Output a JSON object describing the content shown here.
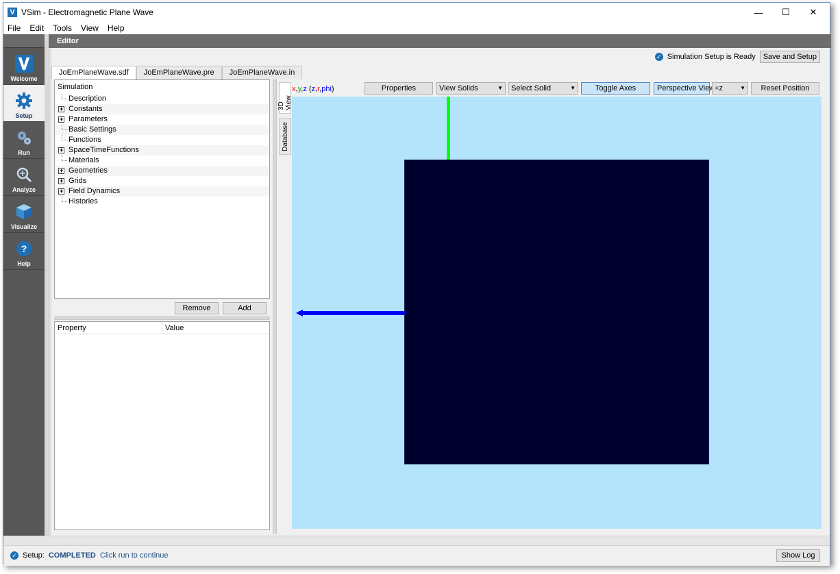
{
  "window": {
    "title": "VSim - Electromagnetic Plane Wave",
    "app_icon_letter": "V",
    "min_glyph": "—",
    "max_glyph": "☐",
    "close_glyph": "✕"
  },
  "menu": [
    "File",
    "Edit",
    "Tools",
    "View",
    "Help"
  ],
  "sidebar": {
    "items": [
      {
        "label": "Welcome",
        "icon": "vsim-logo-icon",
        "active": false
      },
      {
        "label": "Setup",
        "icon": "gear-icon",
        "active": true
      },
      {
        "label": "Run",
        "icon": "gears-icon",
        "active": false
      },
      {
        "label": "Analyze",
        "icon": "magnifier-icon",
        "active": false
      },
      {
        "label": "Visualize",
        "icon": "cube-icon",
        "active": false
      },
      {
        "label": "Help",
        "icon": "question-icon",
        "active": false
      }
    ]
  },
  "editor": {
    "title": "Editor",
    "setup_status": "Simulation Setup is Ready",
    "save_button": "Save and Setup",
    "tabs": [
      "JoEmPlaneWave.sdf",
      "JoEmPlaneWave.pre",
      "JoEmPlaneWave.in"
    ],
    "tree": {
      "root": "Simulation",
      "items": [
        {
          "label": "Description",
          "expandable": false
        },
        {
          "label": "Constants",
          "expandable": true
        },
        {
          "label": "Parameters",
          "expandable": true
        },
        {
          "label": "Basic Settings",
          "expandable": false
        },
        {
          "label": "Functions",
          "expandable": false
        },
        {
          "label": "SpaceTimeFunctions",
          "expandable": true
        },
        {
          "label": "Materials",
          "expandable": false
        },
        {
          "label": "Geometries",
          "expandable": true
        },
        {
          "label": "Grids",
          "expandable": true
        },
        {
          "label": "Field Dynamics",
          "expandable": true
        },
        {
          "label": "Histories",
          "expandable": false
        }
      ]
    },
    "remove_button": "Remove",
    "add_button": "Add",
    "properties": {
      "col_property": "Property",
      "col_value": "Value"
    }
  },
  "view3d": {
    "vtabs": [
      "3D View",
      "Database"
    ],
    "coords": {
      "x": "x",
      "y": "y",
      "z": "z",
      "z2": "z",
      "r": "r",
      "phi": "phi"
    },
    "coord_colors": {
      "x": "#ff0000",
      "y": "#00aa00",
      "z": "#0000ff",
      "r": "#ff0000",
      "phi": "#0000ff"
    },
    "properties_button": "Properties",
    "view_solids": "View Solids",
    "select_solid": "Select Solid",
    "toggle_axes": "Toggle Axes",
    "perspective_view": "Perspective View",
    "direction": "+z",
    "reset_position": "Reset Position",
    "background_color": "#b3e4fb",
    "grid_color": "#00002e"
  },
  "status": {
    "label": "Setup:",
    "state": "COMPLETED",
    "hint": "Click run to continue",
    "show_log": "Show Log"
  }
}
